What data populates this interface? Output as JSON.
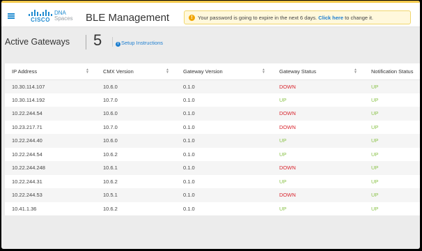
{
  "header": {
    "logo_text": "CISCO",
    "product_line1": "DNA",
    "product_line2": "Spaces",
    "title": "BLE Management",
    "alert": {
      "icon": "!",
      "message": "Your password is going to expire in the next 6 days.",
      "link": "Click here",
      "suffix": "to change it."
    }
  },
  "page": {
    "title": "Active Gateways",
    "count": "5",
    "setup_icon": "i",
    "setup_link": "Setup Instructions"
  },
  "table": {
    "columns": [
      "IP Address",
      "CMX Version",
      "Gateway Version",
      "Gateway Status",
      "Notification Status"
    ],
    "rows": [
      {
        "ip": "10.30.114.107",
        "cmx": "10.6.0",
        "gw": "0.1.0",
        "gw_status": "DOWN",
        "notif": "UP"
      },
      {
        "ip": "10.30.114.192",
        "cmx": "10.7.0",
        "gw": "0.1.0",
        "gw_status": "UP",
        "notif": "UP"
      },
      {
        "ip": "10.22.244.54",
        "cmx": "10.6.0",
        "gw": "0.1.0",
        "gw_status": "DOWN",
        "notif": "UP"
      },
      {
        "ip": "10.23.217.71",
        "cmx": "10.7.0",
        "gw": "0.1.0",
        "gw_status": "DOWN",
        "notif": "UP"
      },
      {
        "ip": "10.22.244.40",
        "cmx": "10.6.0",
        "gw": "0.1.0",
        "gw_status": "UP",
        "notif": "UP"
      },
      {
        "ip": "10.22.244.54",
        "cmx": "10.6.2",
        "gw": "0.1.0",
        "gw_status": "UP",
        "notif": "UP"
      },
      {
        "ip": "10.22.244.248",
        "cmx": "10.6.1",
        "gw": "0.1.0",
        "gw_status": "DOWN",
        "notif": "UP"
      },
      {
        "ip": "10.22.244.31",
        "cmx": "10.6.2",
        "gw": "0.1.0",
        "gw_status": "UP",
        "notif": "UP"
      },
      {
        "ip": "10.22.244.53",
        "cmx": "10.5.1",
        "gw": "0.1.0",
        "gw_status": "DOWN",
        "notif": "UP"
      },
      {
        "ip": "10.41.1.36",
        "cmx": "10.6.2",
        "gw": "0.1.0",
        "gw_status": "UP",
        "notif": "UP"
      }
    ]
  },
  "colors": {
    "accent": "#1e8ad0",
    "status_down": "#d8262f",
    "status_up": "#8bc34a",
    "alert_bg": "#fff8dc"
  }
}
